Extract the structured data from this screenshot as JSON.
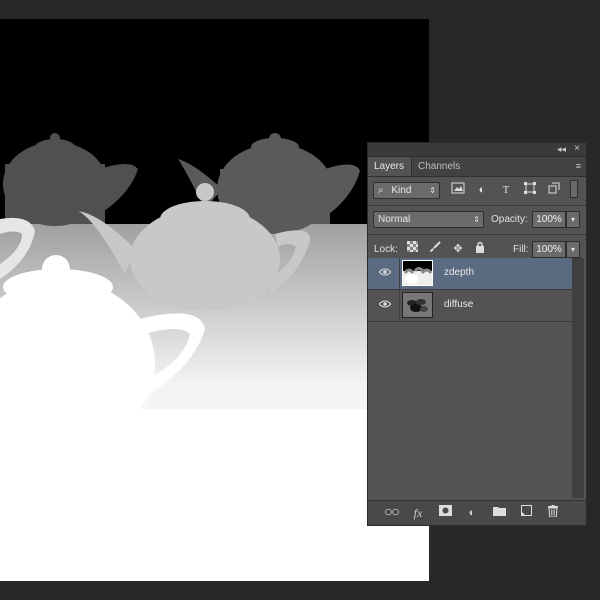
{
  "panel": {
    "collapse_icon": "◂◂",
    "close_icon": "×",
    "tabs": [
      {
        "label": "Layers",
        "active": true
      },
      {
        "label": "Channels",
        "active": false
      }
    ],
    "menu_icon": "≡",
    "filter": {
      "search_icon": "⌕",
      "kind_label": "Kind"
    },
    "blend_mode": "Normal",
    "opacity_label": "Opacity:",
    "opacity_value": "100%",
    "lock_label": "Lock:",
    "fill_label": "Fill:",
    "fill_value": "100%",
    "layers": [
      {
        "name": "zdepth",
        "selected": true,
        "visible": true
      },
      {
        "name": "diffuse",
        "selected": false,
        "visible": true
      }
    ],
    "bottom_icons": [
      "link-layers-icon",
      "fx-icon",
      "mask-icon",
      "adjustment-icon",
      "group-folder-icon",
      "new-layer-icon",
      "trash-icon"
    ],
    "fx_label": "fx"
  },
  "colors": {
    "panel_bg": "#535353",
    "selected_layer": "#5a6a80",
    "workspace_bg": "#282828"
  }
}
